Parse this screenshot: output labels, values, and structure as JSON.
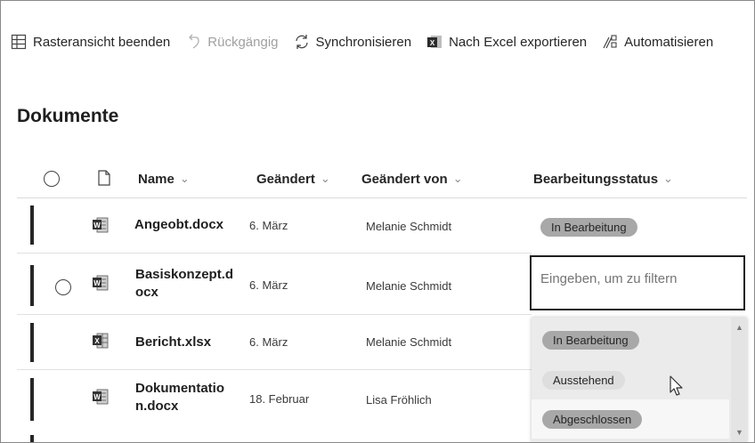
{
  "toolbar": {
    "grid_exit": "Rasteransicht beenden",
    "undo": "Rückgängig",
    "sync": "Synchronisieren",
    "export": "Nach Excel exportieren",
    "automate": "Automatisieren"
  },
  "page_title": "Dokumente",
  "columns": {
    "name": "Name",
    "modified": "Geändert",
    "modified_by": "Geändert von",
    "status": "Bearbeitungsstatus"
  },
  "rows": [
    {
      "name": "Angeobt.docx",
      "modified": "6. März",
      "modified_by": "Melanie Schmidt",
      "status": "In Bearbeitung",
      "file_icon": "word-file-icon"
    },
    {
      "name": "Basiskonzept.d ocx",
      "name_l1": "Basiskonzept.d",
      "name_l2": "ocx",
      "modified": "6. März",
      "modified_by": "Melanie Schmidt",
      "file_icon": "word-file-icon"
    },
    {
      "name": "Bericht.xlsx",
      "modified": "6. März",
      "modified_by": "Melanie Schmidt",
      "file_icon": "excel-file-icon"
    },
    {
      "name": "Dokumentatio n.docx",
      "name_l1": "Dokumentatio",
      "name_l2": "n.docx",
      "modified": "18. Februar",
      "modified_by": "Lisa Fröhlich",
      "file_icon": "word-file-icon"
    }
  ],
  "filter": {
    "placeholder": "Eingeben, um zu filtern"
  },
  "status_options": [
    "In Bearbeitung",
    "Ausstehend",
    "Abgeschlossen"
  ],
  "colors": {
    "pill_dark": "#a8a8a8",
    "pill_light": "#dedede"
  }
}
